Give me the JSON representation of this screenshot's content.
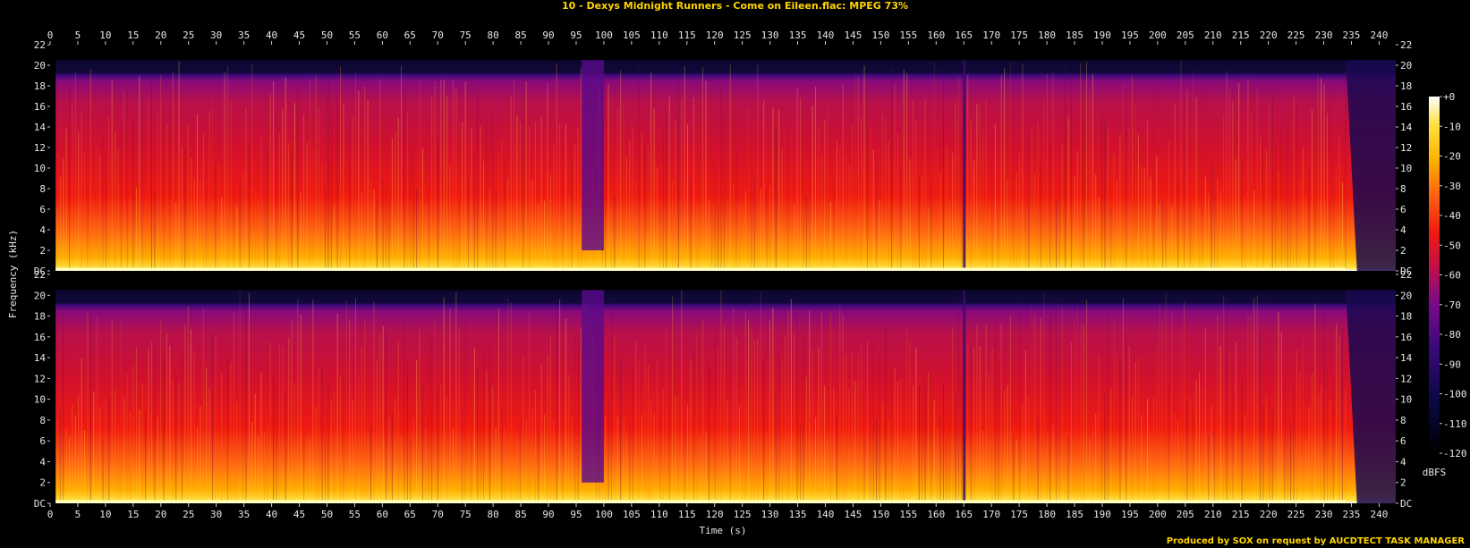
{
  "title": "10 - Dexys Midnight Runners - Come on Eileen.flac: MPEG 73%",
  "footer": "Produced by SOX on request by AUCDTECT TASK MANAGER",
  "chart_data": {
    "type": "heatmap",
    "xlabel": "Time (s)",
    "ylabel": "Frequency (kHz)",
    "colorbar_label": "dBFS",
    "xlim": [
      0,
      243
    ],
    "ylim": [
      0,
      22
    ],
    "x_ticks": [
      0,
      5,
      10,
      15,
      20,
      25,
      30,
      35,
      40,
      45,
      50,
      55,
      60,
      65,
      70,
      75,
      80,
      85,
      90,
      95,
      100,
      105,
      110,
      115,
      120,
      125,
      130,
      135,
      140,
      145,
      150,
      155,
      160,
      165,
      170,
      175,
      180,
      185,
      190,
      195,
      200,
      205,
      210,
      215,
      220,
      225,
      230,
      235,
      240
    ],
    "y_ticks": [
      "DC",
      "2",
      "4",
      "6",
      "8",
      "10",
      "12",
      "14",
      "16",
      "18",
      "20",
      "22"
    ],
    "colorbar_range": [
      -120,
      0
    ],
    "colorbar_ticks": [
      "+0",
      "-10",
      "-20",
      "-30",
      "-40",
      "-50",
      "-60",
      "-70",
      "-80",
      "-90",
      "-100",
      "-110",
      "-120"
    ],
    "channels": 2,
    "spectral_cutoff_khz": 20.5,
    "colormap": [
      "#000000",
      "#0b0845",
      "#3a0a7a",
      "#7a0a8a",
      "#c0104a",
      "#f01a10",
      "#ff6010",
      "#ffb000",
      "#ffe040",
      "#ffffff"
    ],
    "features": [
      {
        "label": "quiet section",
        "time_range_s": [
          96,
          100
        ]
      },
      {
        "label": "transition",
        "time_s": 165
      },
      {
        "label": "fade-out",
        "time_range_s": [
          234,
          243
        ]
      }
    ]
  }
}
